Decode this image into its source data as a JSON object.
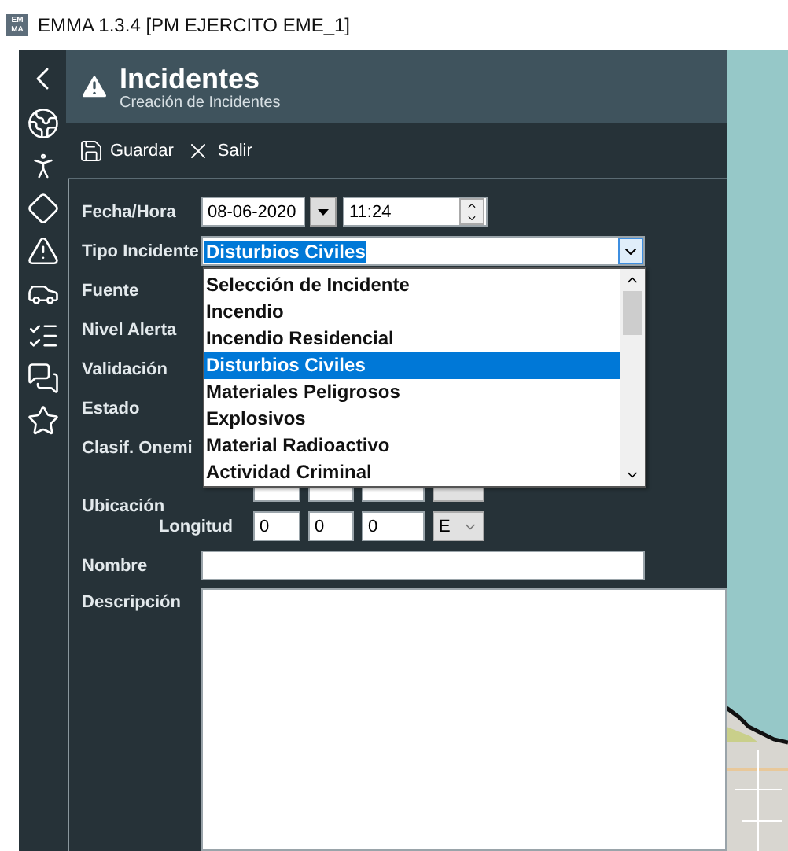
{
  "window": {
    "title": "EMMA 1.3.4 [PM EJERCITO EME_1]",
    "logo_top": "EM",
    "logo_bottom": "MA"
  },
  "header": {
    "title": "Incidentes",
    "subtitle": "Creación de Incidentes"
  },
  "toolbar": [
    {
      "kind": "save",
      "label": "Guardar"
    },
    {
      "kind": "close",
      "label": "Salir"
    }
  ],
  "form": {
    "fecha": {
      "label": "Fecha/Hora",
      "date": "08-06-2020",
      "time": "11:24"
    },
    "tipo": {
      "label": "Tipo Incidente",
      "value": "Disturbios Civiles",
      "expanded": true,
      "options": [
        {
          "label": "Selección de Incidente",
          "selected": false
        },
        {
          "label": "Incendio",
          "selected": false
        },
        {
          "label": "Incendio Residencial",
          "selected": false
        },
        {
          "label": "Disturbios Civiles",
          "selected": true
        },
        {
          "label": "Materiales Peligrosos",
          "selected": false
        },
        {
          "label": "Explosivos",
          "selected": false
        },
        {
          "label": "Material Radioactivo",
          "selected": false
        },
        {
          "label": "Actividad Criminal",
          "selected": false
        }
      ]
    },
    "hidden_rows": [
      {
        "label": "Fuente"
      },
      {
        "label": "Nivel Alerta"
      },
      {
        "label": "Validación"
      },
      {
        "label": "Estado"
      },
      {
        "label": "Clasif. Onemi"
      }
    ],
    "ubicacion": {
      "label": "Ubicación",
      "coords": [
        {
          "label": "Longitud",
          "degrees": "0",
          "minutes": "0",
          "seconds": "0",
          "hemisphere": "E"
        }
      ]
    },
    "nombre": {
      "label": "Nombre"
    },
    "descripcion": {
      "label": "Descripción"
    }
  }
}
